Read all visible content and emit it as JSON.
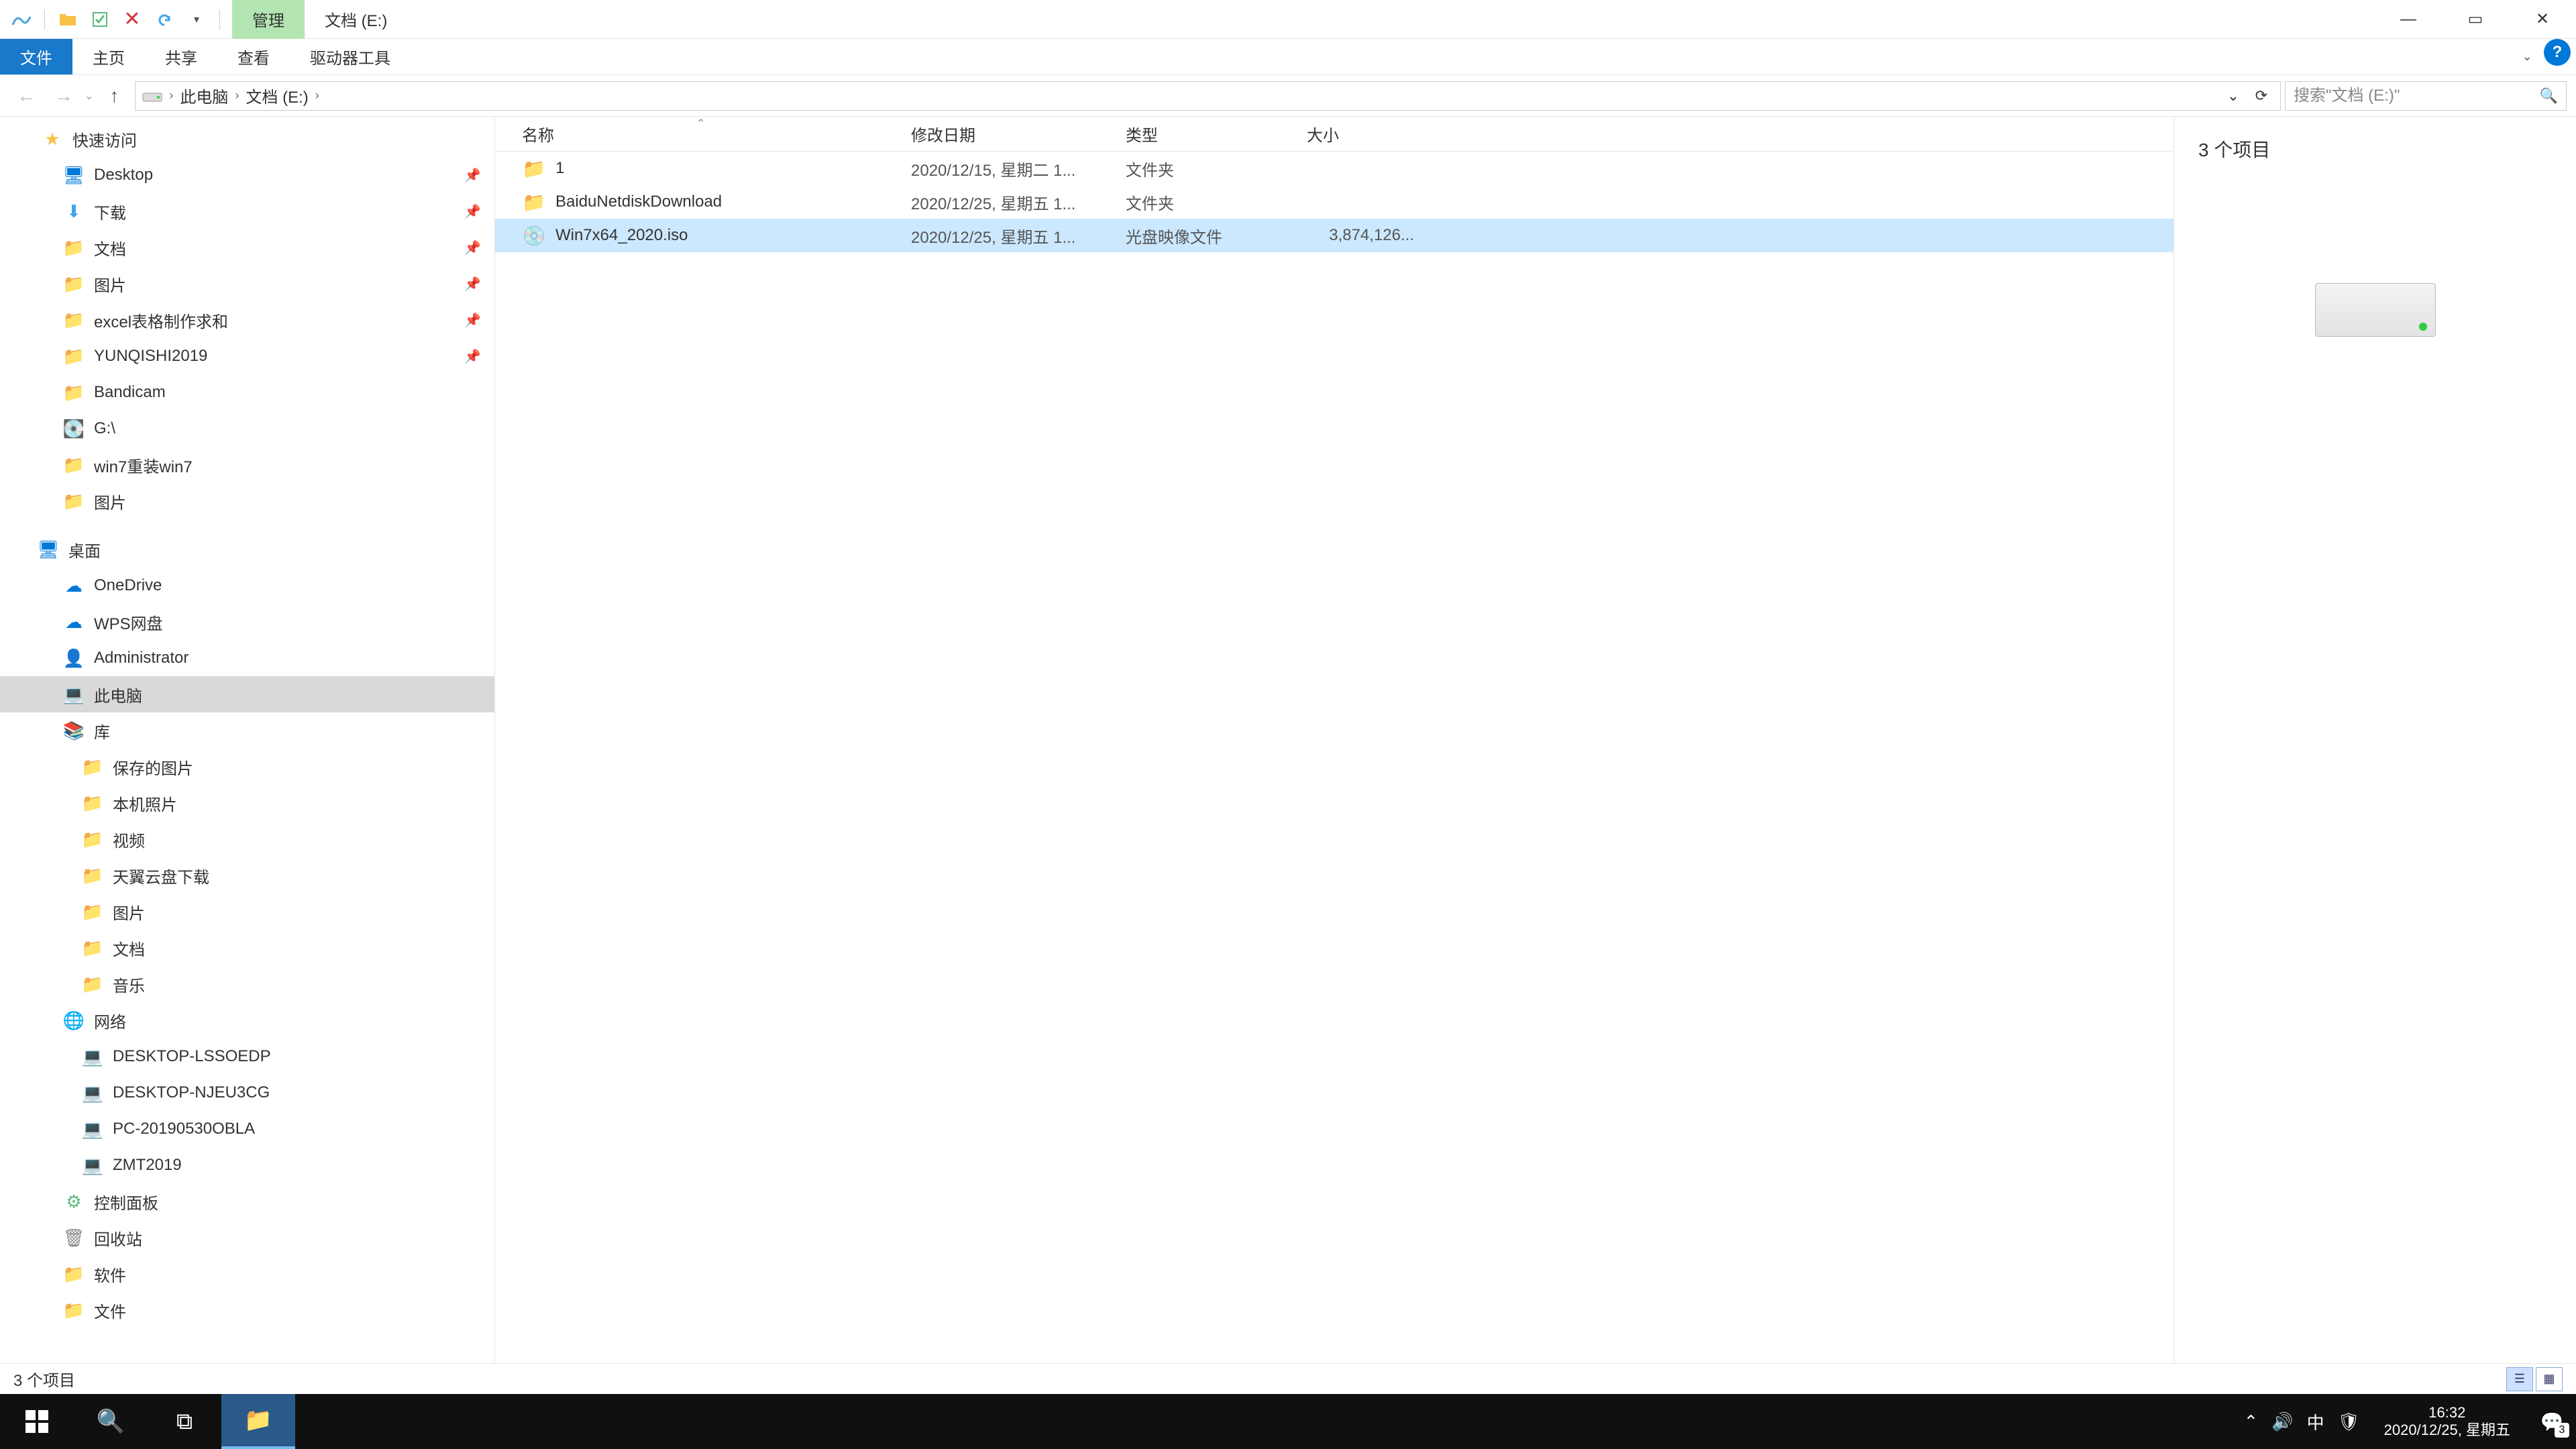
{
  "title": {
    "contextual_tab": "管理",
    "window_title": "文档 (E:)"
  },
  "ribbon": {
    "tabs": [
      "文件",
      "主页",
      "共享",
      "查看",
      "驱动器工具"
    ],
    "active_index": 0
  },
  "nav_buttons": {
    "back": "←",
    "forward": "→",
    "up": "↑"
  },
  "breadcrumbs": [
    "此电脑",
    "文档 (E:)"
  ],
  "search": {
    "placeholder": "搜索\"文档 (E:)\""
  },
  "navtree": {
    "groups": [
      {
        "root": {
          "icon": "star",
          "label": "快速访问"
        },
        "items": [
          {
            "icon": "desk",
            "label": "Desktop",
            "pinned": true
          },
          {
            "icon": "blue",
            "label": "下载",
            "pinned": true
          },
          {
            "icon": "folder",
            "label": "文档",
            "pinned": true
          },
          {
            "icon": "folder",
            "label": "图片",
            "pinned": true
          },
          {
            "icon": "folder",
            "label": "excel表格制作求和",
            "pinned": true
          },
          {
            "icon": "folder",
            "label": "YUNQISHI2019",
            "pinned": true
          },
          {
            "icon": "folder",
            "label": "Bandicam"
          },
          {
            "icon": "drive",
            "label": "G:\\"
          },
          {
            "icon": "folder",
            "label": "win7重装win7"
          },
          {
            "icon": "folder",
            "label": "图片"
          }
        ]
      },
      {
        "root": {
          "icon": "desk",
          "label": "桌面"
        },
        "items": [
          {
            "icon": "cloud",
            "label": "OneDrive"
          },
          {
            "icon": "cloud",
            "label": "WPS网盘"
          },
          {
            "icon": "user",
            "label": "Administrator"
          },
          {
            "icon": "pc",
            "label": "此电脑",
            "selected": true
          },
          {
            "icon": "lib",
            "label": "库"
          }
        ]
      },
      {
        "root": null,
        "items": [
          {
            "icon": "folder",
            "label": "保存的图片",
            "lvl": 2
          },
          {
            "icon": "folder",
            "label": "本机照片",
            "lvl": 2
          },
          {
            "icon": "folder",
            "label": "视频",
            "lvl": 2
          },
          {
            "icon": "folder",
            "label": "天翼云盘下载",
            "lvl": 2
          },
          {
            "icon": "folder",
            "label": "图片",
            "lvl": 2
          },
          {
            "icon": "folder",
            "label": "文档",
            "lvl": 2
          },
          {
            "icon": "folder",
            "label": "音乐",
            "lvl": 2
          }
        ]
      },
      {
        "root": {
          "icon": "net",
          "label": "网络",
          "lvl": 1
        },
        "items": [
          {
            "icon": "pc",
            "label": "DESKTOP-LSSOEDP",
            "lvl": 2
          },
          {
            "icon": "pc",
            "label": "DESKTOP-NJEU3CG",
            "lvl": 2
          },
          {
            "icon": "pc",
            "label": "PC-20190530OBLA",
            "lvl": 2
          },
          {
            "icon": "pc",
            "label": "ZMT2019",
            "lvl": 2
          }
        ]
      },
      {
        "root": null,
        "items": [
          {
            "icon": "panel",
            "label": "控制面板"
          },
          {
            "icon": "recycle",
            "label": "回收站"
          },
          {
            "icon": "folder",
            "label": "软件"
          },
          {
            "icon": "folder",
            "label": "文件"
          }
        ]
      }
    ]
  },
  "columns": {
    "name": "名称",
    "date": "修改日期",
    "type": "类型",
    "size": "大小"
  },
  "files": [
    {
      "icon": "folder",
      "name": "1",
      "date": "2020/12/15, 星期二 1...",
      "type": "文件夹",
      "size": ""
    },
    {
      "icon": "folder",
      "name": "BaiduNetdiskDownload",
      "date": "2020/12/25, 星期五 1...",
      "type": "文件夹",
      "size": ""
    },
    {
      "icon": "disc",
      "name": "Win7x64_2020.iso",
      "date": "2020/12/25, 星期五 1...",
      "type": "光盘映像文件",
      "size": "3,874,126...",
      "selected": true
    }
  ],
  "preview": {
    "summary": "3 个项目"
  },
  "statusbar": {
    "text": "3 个项目"
  },
  "taskbar": {
    "clock_time": "16:32",
    "clock_date": "2020/12/25, 星期五",
    "ime": "中",
    "notif_count": "3"
  }
}
